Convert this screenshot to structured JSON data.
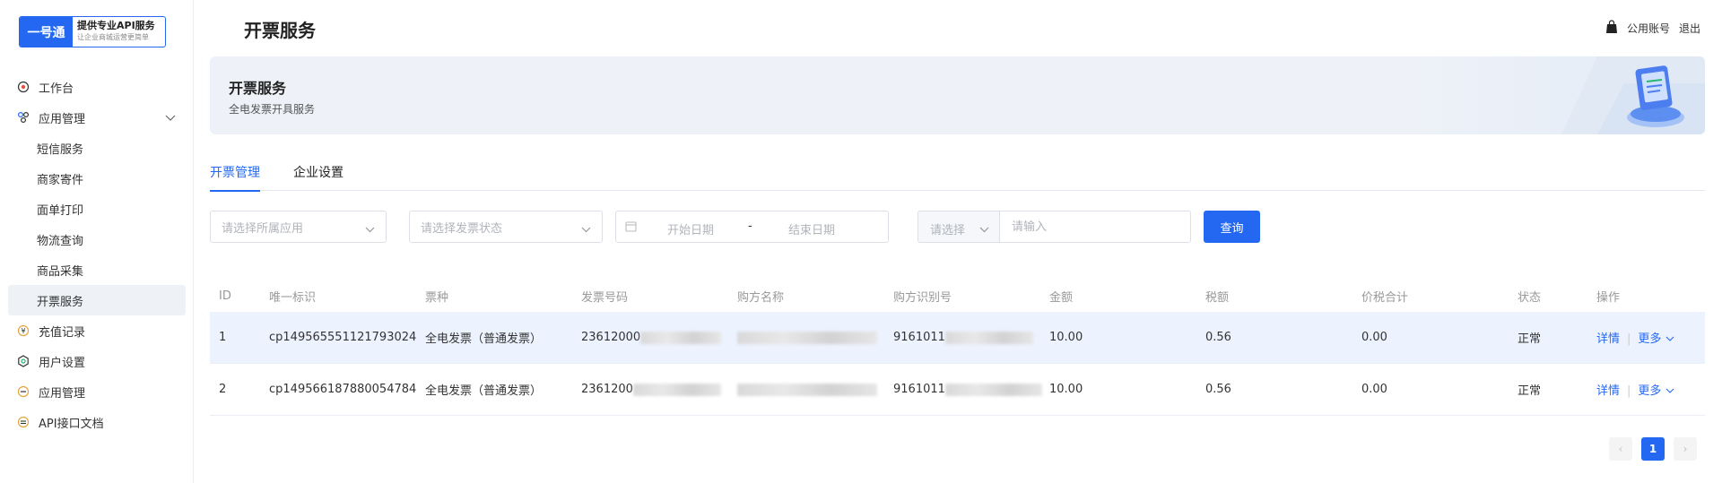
{
  "logo": {
    "mark": "一号通",
    "main": "提供专业API服务",
    "sub": "让企业商城运营更简单"
  },
  "sidebar": {
    "items": [
      {
        "label": "工作台",
        "icon": "target-icon"
      },
      {
        "label": "应用管理",
        "icon": "app-nodes-icon",
        "expanded": true,
        "children": [
          "短信服务",
          "商家寄件",
          "面单打印",
          "物流查询",
          "商品采集",
          "开票服务"
        ]
      },
      {
        "label": "充值记录",
        "icon": "yen-icon"
      },
      {
        "label": "用户设置",
        "icon": "settings-icon"
      },
      {
        "label": "应用管理",
        "icon": "minus-circle-icon"
      },
      {
        "label": "API接口文档",
        "icon": "doc-icon"
      }
    ],
    "active_child": "开票服务"
  },
  "header": {
    "title": "开票服务",
    "account": "公用账号",
    "logout": "退出"
  },
  "banner": {
    "title": "开票服务",
    "subtitle": "全电发票开具服务"
  },
  "tabs": [
    "开票管理",
    "企业设置"
  ],
  "active_tab": "开票管理",
  "filters": {
    "app_placeholder": "请选择所属应用",
    "status_placeholder": "请选择发票状态",
    "start_placeholder": "开始日期",
    "date_sep": "-",
    "end_placeholder": "结束日期",
    "combo_select": "请选择",
    "combo_placeholder": "请输入",
    "query": "查询"
  },
  "table": {
    "headers": [
      "ID",
      "唯一标识",
      "票种",
      "发票号码",
      "购方名称",
      "购方识别号",
      "金额",
      "税额",
      "价税合计",
      "状态",
      "操作"
    ],
    "rows": [
      {
        "id": "1",
        "uid": "cp149565551121793024",
        "type": "全电发票（普通发票）",
        "invoice_no": "23612000",
        "buyer_name": "",
        "buyer_tax": "9161011",
        "amount": "10.00",
        "tax": "0.56",
        "total": "0.00",
        "status": "正常",
        "detail": "详情",
        "more": "更多"
      },
      {
        "id": "2",
        "uid": "cp149566187880054784",
        "type": "全电发票（普通发票）",
        "invoice_no": "2361200",
        "buyer_name": "",
        "buyer_tax": "9161011",
        "amount": "10.00",
        "tax": "0.56",
        "total": "0.00",
        "status": "正常",
        "detail": "详情",
        "more": "更多"
      }
    ]
  },
  "pagination": {
    "current": "1",
    "prev": "‹",
    "next": "›"
  },
  "colors": {
    "primary": "#2468f2",
    "row_highlight": "#ecf3fe"
  }
}
